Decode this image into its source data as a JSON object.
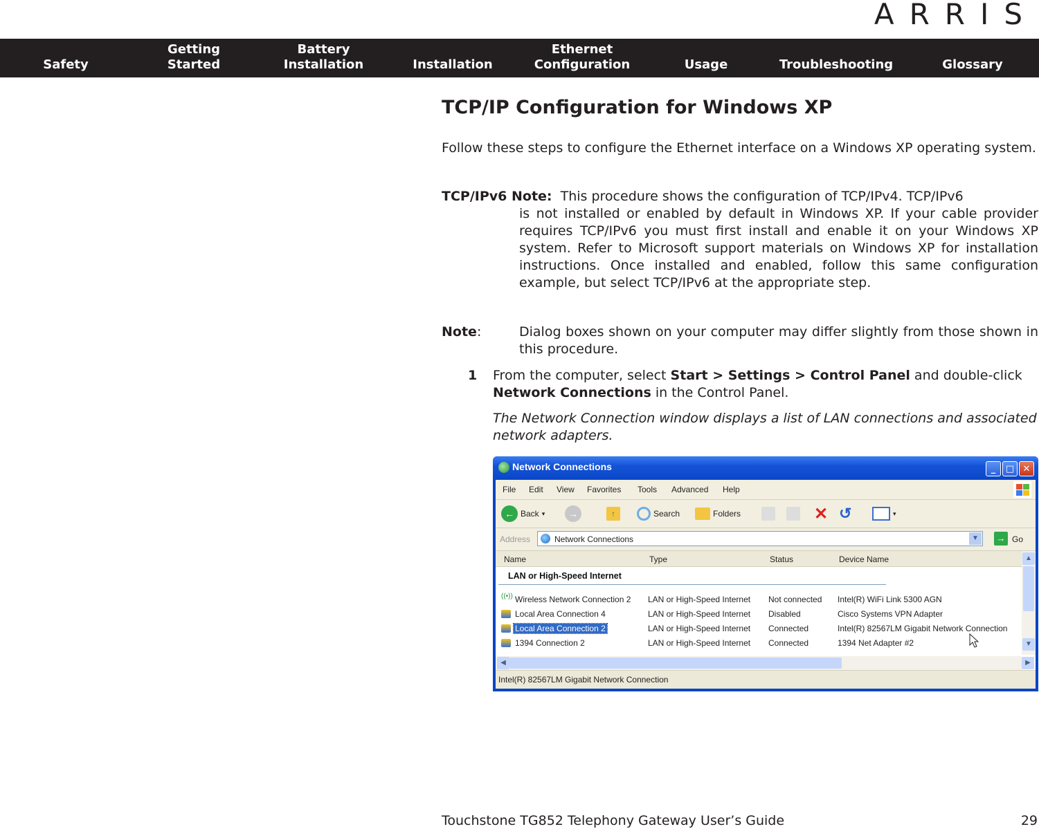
{
  "brand": {
    "logo_text": "ARRIS"
  },
  "nav": {
    "items": [
      {
        "label_line1": "",
        "label_line2": "Safety"
      },
      {
        "label_line1": "Getting",
        "label_line2": "Started"
      },
      {
        "label_line1": "Battery",
        "label_line2": "Installation"
      },
      {
        "label_line1": "",
        "label_line2": "Installation"
      },
      {
        "label_line1": "Ethernet",
        "label_line2": "Configuration"
      },
      {
        "label_line1": "",
        "label_line2": "Usage"
      },
      {
        "label_line1": "",
        "label_line2": "Troubleshooting"
      },
      {
        "label_line1": "",
        "label_line2": "Glossary"
      }
    ]
  },
  "page": {
    "title": "TCP/IP Configuration for Windows XP",
    "intro": "Follow these steps to configure the Ethernet interface on a Windows XP operating system.",
    "ipv6_note": {
      "label": "TCP/IPv6 Note:",
      "first_line": "This procedure shows the configuration of TCP/IPv4.  TCP/IPv6",
      "body": "is not installed or enabled by default in Windows XP.  If your cable provider requires TCP/IPv6 you must first install and enable it on your Windows XP system.  Refer to Microsoft support materials on Windows XP for installation instructions.  Once installed and enabled, follow this same configuration example, but select TCP/IPv6 at the appropriate step."
    },
    "note": {
      "label": "Note",
      "colon": ":",
      "body": "Dialog boxes shown on your computer may differ slightly from those shown in this procedure."
    },
    "step1": {
      "number": "1",
      "text_a": "From the computer, select ",
      "bold_a": "Start > Settings > Control Panel",
      "text_b": " and double-click ",
      "bold_b": "Network Connections",
      "text_c": " in the Control Panel.",
      "result": "The Network Connection window displays a list of LAN connections and associated network adapters."
    }
  },
  "xp_window": {
    "title": "Network Connections",
    "buttons": {
      "minimize": "_",
      "maximize": "□",
      "close": "✕"
    },
    "menu": [
      "File",
      "Edit",
      "View",
      "Favorites",
      "Tools",
      "Advanced",
      "Help"
    ],
    "toolbar": {
      "back": "Back",
      "search": "Search",
      "folders": "Folders"
    },
    "address": {
      "label": "Address",
      "value": "Network Connections",
      "go": "Go"
    },
    "columns": [
      "Name",
      "Type",
      "Status",
      "Device Name"
    ],
    "group": "LAN or High-Speed Internet",
    "rows": [
      {
        "name": "Wireless Network Connection 2",
        "type": "LAN or High-Speed Internet",
        "status": "Not connected",
        "device": "Intel(R) WiFi Link 5300 AGN",
        "icon": "wireless-icon",
        "selected": false
      },
      {
        "name": "Local Area Connection 4",
        "type": "LAN or High-Speed Internet",
        "status": "Disabled",
        "device": "Cisco Systems VPN Adapter",
        "icon": "lan-icon",
        "selected": false
      },
      {
        "name": "Local Area Connection 2",
        "type": "LAN or High-Speed Internet",
        "status": "Connected",
        "device": "Intel(R) 82567LM Gigabit Network Connection",
        "icon": "lan-icon",
        "selected": true
      },
      {
        "name": "1394 Connection 2",
        "type": "LAN or High-Speed Internet",
        "status": "Connected",
        "device": "1394 Net Adapter #2",
        "icon": "lan-icon",
        "selected": false
      }
    ],
    "status_bar": "Intel(R) 82567LM Gigabit Network Connection"
  },
  "footer": {
    "guide_title": "Touchstone TG852 Telephony Gateway User’s Guide",
    "page_number": "29"
  },
  "colors": {
    "navbar_bg": "#231f20",
    "text": "#231f20",
    "xp_blue": "#0a45c4",
    "selection": "#316ac5"
  }
}
